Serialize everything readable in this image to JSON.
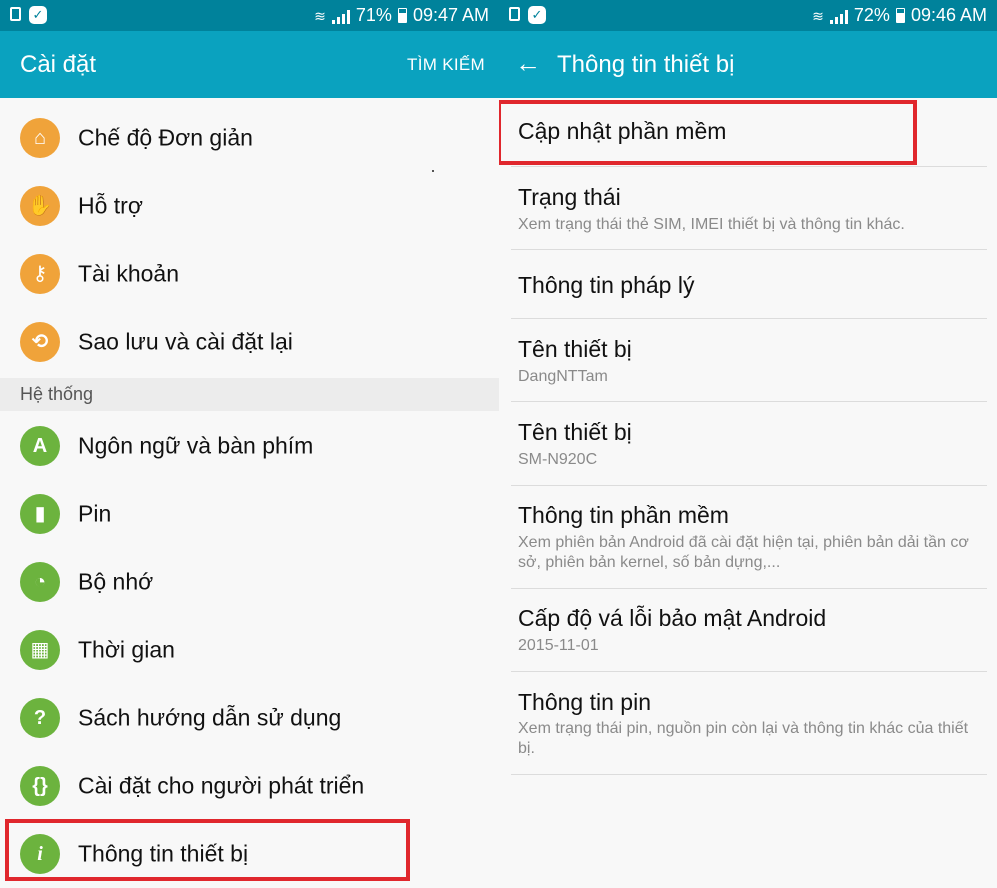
{
  "left_screen": {
    "status": {
      "battery": "71%",
      "time": "09:47 AM",
      "battery_level": 0.71
    },
    "title": "Cài đặt",
    "action": "TÌM KIẾM",
    "items": [
      {
        "label": "Chế độ Đơn giản",
        "icon": "home-icon",
        "glyph": "⌂"
      },
      {
        "label": "Hỗ trợ",
        "icon": "hand-icon",
        "glyph": "✋"
      },
      {
        "label": "Tài khoản",
        "icon": "key-icon",
        "glyph": "⚷"
      },
      {
        "label": "Sao lưu và cài đặt lại",
        "icon": "backup-icon",
        "glyph": "⟲"
      }
    ],
    "section_header": "Hệ thống",
    "system_items": [
      {
        "label": "Ngôn ngữ và bàn phím",
        "icon": "language-icon",
        "glyph": "A"
      },
      {
        "label": "Pin",
        "icon": "battery-icon",
        "glyph": "▮"
      },
      {
        "label": "Bộ nhớ",
        "icon": "storage-icon",
        "glyph": "◔"
      },
      {
        "label": "Thời gian",
        "icon": "calendar-icon",
        "glyph": "▦"
      },
      {
        "label": "Sách hướng dẫn sử dụng",
        "icon": "manual-icon",
        "glyph": "?"
      },
      {
        "label": "Cài đặt cho người phát triển",
        "icon": "developer-icon",
        "glyph": "{}"
      },
      {
        "label": "Thông tin thiết bị",
        "icon": "info-icon",
        "glyph": "i"
      }
    ]
  },
  "right_screen": {
    "status": {
      "battery": "72%",
      "time": "09:46 AM",
      "battery_level": 0.72
    },
    "title": "Thông tin thiết bị",
    "items": [
      {
        "title": "Cập nhật phần mềm",
        "subtitle": ""
      },
      {
        "title": "Trạng thái",
        "subtitle": "Xem trạng thái thẻ SIM, IMEI thiết bị và thông tin khác."
      },
      {
        "title": "Thông tin pháp lý",
        "subtitle": ""
      },
      {
        "title": "Tên thiết bị",
        "subtitle": "DangNTTam"
      },
      {
        "title": "Tên thiết bị",
        "subtitle": "SM-N920C"
      },
      {
        "title": "Thông tin phần mềm",
        "subtitle": "Xem phiên bản Android đã cài đặt hiện tại, phiên bản dải tần cơ sở, phiên bản kernel, số bản dựng,..."
      },
      {
        "title": "Cấp độ vá lỗi bảo mật Android",
        "subtitle": "2015-11-01"
      },
      {
        "title": "Thông tin pin",
        "subtitle": "Xem trạng thái pin, nguồn pin còn lại và thông tin khác của thiết bị."
      }
    ]
  },
  "colors": {
    "status_bar": "#00829b",
    "app_bar": "#0aa2bf",
    "highlight": "#e0272d",
    "orange_icon": "#f0a33a",
    "green_icon": "#6cb33e"
  }
}
